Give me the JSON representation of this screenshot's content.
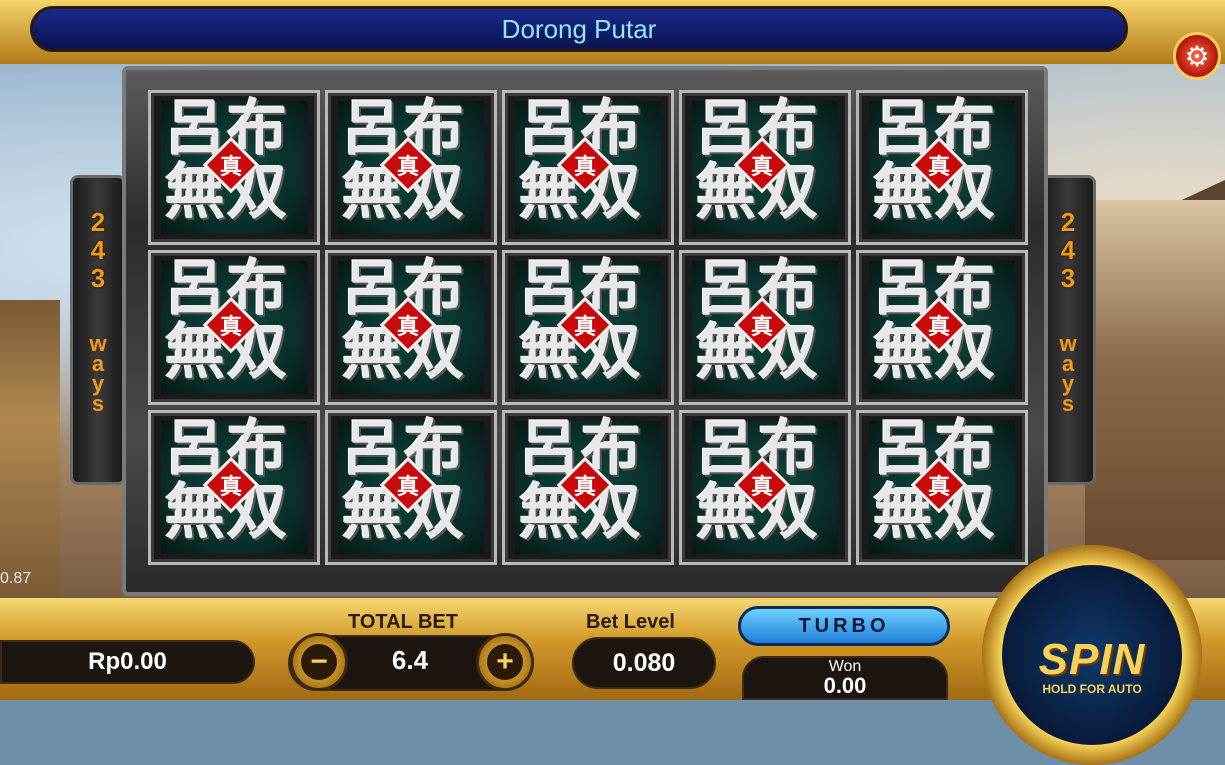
{
  "game": {
    "title": "Dorong Putar"
  },
  "ways": {
    "left": {
      "number": [
        "2",
        "4",
        "3"
      ],
      "word": [
        "w",
        "a",
        "y",
        "s"
      ]
    },
    "right": {
      "number": [
        "2",
        "4",
        "3"
      ],
      "word": [
        "w",
        "a",
        "y",
        "s"
      ]
    }
  },
  "reels": {
    "columns": 5,
    "rows": 3,
    "symbol": {
      "top_left": "呂",
      "top_right": "布",
      "bottom_left": "無",
      "bottom_right": "双",
      "center": "真"
    },
    "symbol_name": "lu-bu-musou-symbol"
  },
  "side_value_left": "0.87",
  "footer": {
    "balance": "Rp0.00",
    "total_bet_label": "TOTAL BET",
    "total_bet_value": "6.4",
    "bet_level_label": "Bet Level",
    "bet_level_value": "0.080",
    "turbo_label": "TURBO",
    "won_label": "Won",
    "won_value": "0.00",
    "spin_label": "SPIN",
    "spin_sub": "HOLD FOR AUTO",
    "minus_symbol": "−",
    "plus_symbol": "+"
  },
  "colors": {
    "title_text": "#8fe8ff",
    "ways_text": "#f19a16",
    "gold": "#f5d25a",
    "symbol_red": "#c80a0a",
    "turbo_blue": "#1f7ed6"
  },
  "icons": {
    "settings": "gear-icon"
  }
}
